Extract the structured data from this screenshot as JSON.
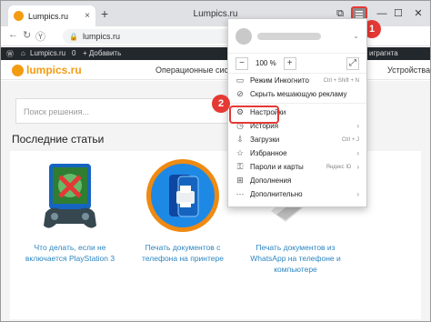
{
  "browser": {
    "tab_title": "Lumpics.ru",
    "window_title": "Lumpics.ru",
    "url": "lumpics.ru",
    "new_tab": "+",
    "tab_close": "×",
    "btn_min": "—",
    "btn_max": "☐",
    "btn_close": "✕"
  },
  "wpbar": {
    "item1": "Lumpics.ru",
    "item2": "0",
    "item3": "+ Добавить",
    "right": "играгнта"
  },
  "site": {
    "logo": "lumpics.ru",
    "nav_center": "Операционные сист",
    "nav_right": "Устройства",
    "search_placeholder": "Поиск решения...",
    "section_title": "Последние статьи"
  },
  "articles": [
    {
      "caption": "Что делать, если не включается PlayStation 3"
    },
    {
      "caption": "Печать документов с телефона на принтере"
    },
    {
      "caption": "Печать документов из WhatsApp на телефоне и компьютере"
    }
  ],
  "menu": {
    "zoom_minus": "−",
    "zoom_value": "100 %",
    "zoom_plus": "+",
    "items": [
      {
        "label": "Режим Инкогнито",
        "hint": "Ctrl + Shift + N"
      },
      {
        "label": "Скрыть мешающую рекламу",
        "hint": ""
      },
      {
        "label": "Настройки",
        "hint": ""
      },
      {
        "label": "История",
        "hint": ""
      },
      {
        "label": "Загрузки",
        "hint": "Ctrl + J"
      },
      {
        "label": "Избранное",
        "hint": ""
      },
      {
        "label": "Пароли и карты",
        "hint": "Яндекс ID"
      },
      {
        "label": "Дополнения",
        "hint": ""
      },
      {
        "label": "Дополнительно",
        "hint": ""
      }
    ]
  },
  "badges": {
    "one": "1",
    "two": "2"
  },
  "colors": {
    "accent": "#f39c12",
    "link": "#2e86c1",
    "highlight": "#e53935"
  }
}
